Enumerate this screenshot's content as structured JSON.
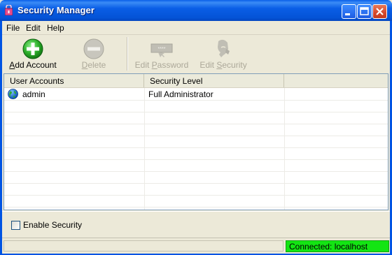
{
  "window": {
    "title": "Security Manager"
  },
  "menu": {
    "items": [
      {
        "label": "File"
      },
      {
        "label": "Edit"
      },
      {
        "label": "Help"
      }
    ]
  },
  "toolbar": {
    "add_account": {
      "label_pre": "",
      "label_key": "A",
      "label_post": "dd Account",
      "icon": "add-circle-icon",
      "enabled": true
    },
    "delete": {
      "label_pre": "",
      "label_key": "D",
      "label_post": "elete",
      "icon": "delete-circle-icon",
      "enabled": false
    },
    "edit_password": {
      "label_pre": "Edit ",
      "label_key": "P",
      "label_post": "assword",
      "icon": "password-icon",
      "enabled": false
    },
    "edit_security": {
      "label_pre": "Edit ",
      "label_key": "S",
      "label_post": "ecurity",
      "icon": "security-icon",
      "enabled": false
    }
  },
  "table": {
    "columns": [
      "User Accounts",
      "Security Level"
    ],
    "rows": [
      {
        "account": "admin",
        "level": "Full Administrator",
        "icon": "globe-icon"
      }
    ]
  },
  "options": {
    "enable_security_label": "Enable Security",
    "enable_security_checked": false
  },
  "status": {
    "connection": "Connected: localhost",
    "connection_color": "#13e513"
  },
  "colors": {
    "titlebar": "#0454d8",
    "window_bg": "#ece9d8"
  }
}
